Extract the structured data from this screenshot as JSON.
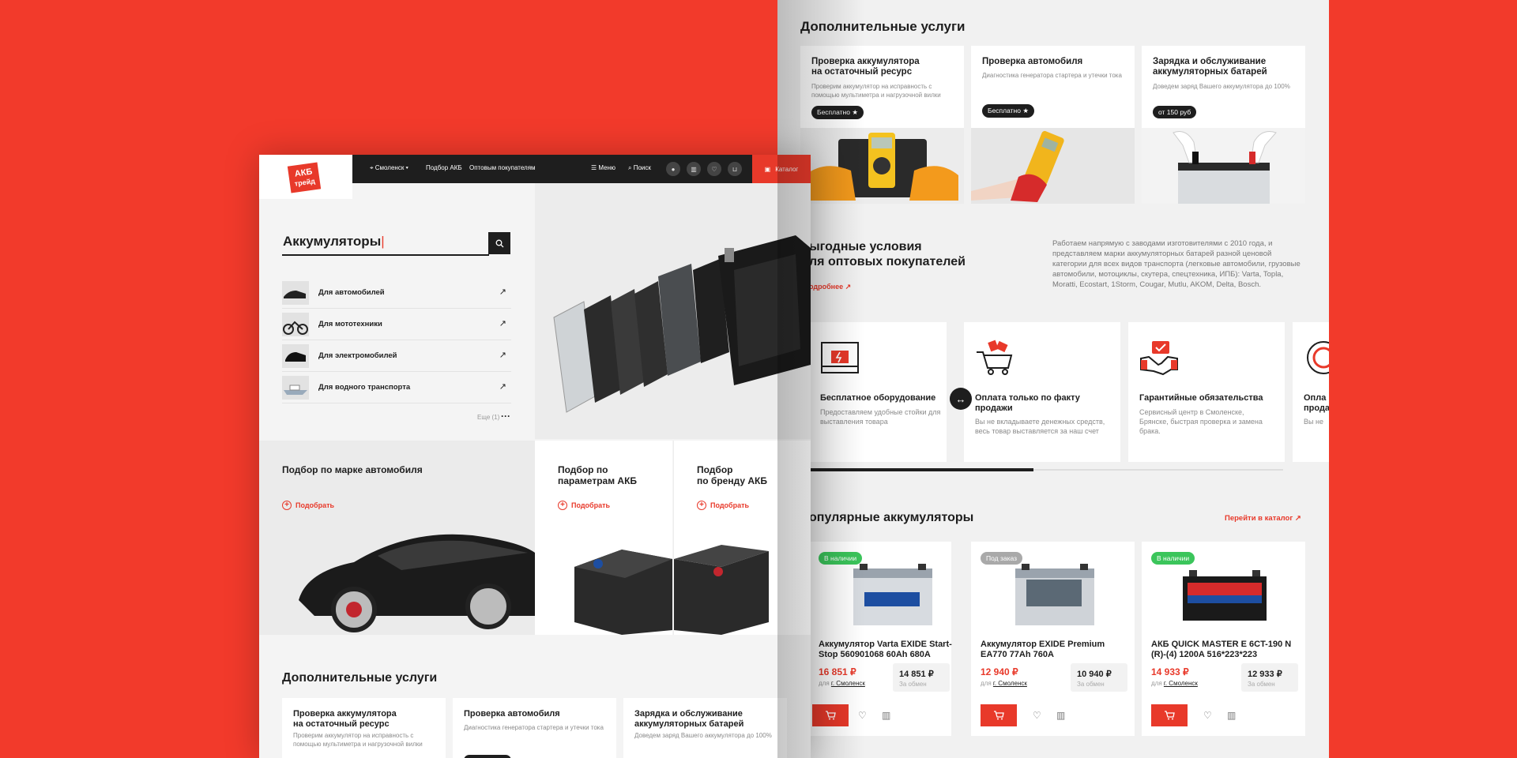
{
  "front": {
    "logo": {
      "line1": "АКБ",
      "line2": "трейд"
    },
    "nav": {
      "city": "Смоленск",
      "pick_akb": "Подбор АКБ",
      "wholesale": "Оптовым покупателям",
      "menu": "Меню",
      "search": "Поиск",
      "catalog": "Каталог"
    },
    "search": {
      "title": "Аккумуляторы"
    },
    "categories": [
      {
        "label": "Для автомобилей"
      },
      {
        "label": "Для мототехники"
      },
      {
        "label": "Для электромобилей"
      },
      {
        "label": "Для водного транспорта"
      }
    ],
    "more_label": "Еще (1)",
    "pickers": [
      {
        "title": "Подбор по марке автомобиля",
        "action": "Подобрать"
      },
      {
        "title_line1": "Подбор по",
        "title_line2": "параметрам АКБ",
        "action": "Подобрать"
      },
      {
        "title_line1": "Подбор",
        "title_line2": "по бренду АКБ",
        "action": "Подобрать"
      }
    ],
    "extra": {
      "title": "Дополнительные услуги",
      "cards": [
        {
          "title_line1": "Проверка аккумулятора",
          "title_line2": "на остаточный ресурс",
          "desc": "Проверим аккумулятор на исправность с помощью мультиметра и нагрузочной вилки"
        },
        {
          "title_line1": "Проверка автомобиля",
          "title_line2": "",
          "desc": "Диагностика генератора стартера и утечки тока"
        },
        {
          "title_line1": "Зарядка и обслуживание",
          "title_line2": "аккумуляторных батарей",
          "desc": "Доведем заряд Вашего аккумулятора до 100%"
        }
      ]
    }
  },
  "back": {
    "services": {
      "title": "Дополнительные услуги",
      "cards": [
        {
          "title_line1": "Проверка аккумулятора",
          "title_line2": "на остаточный ресурс",
          "desc": "Проверим аккумулятор на исправность с помощью мультиметра и нагрузочной вилки",
          "badge": "Бесплатно ★"
        },
        {
          "title_line1": "Проверка автомобиля",
          "title_line2": "",
          "desc": "Диагностика генератора стартера и утечки тока",
          "badge": "Бесплатно ★"
        },
        {
          "title_line1": "Зарядка и обслуживание",
          "title_line2": "аккумуляторных батарей",
          "desc": "Доведем заряд Вашего аккумулятора до 100%",
          "badge": "от 150 руб"
        }
      ]
    },
    "wholesale": {
      "title_line1": "ыгодные условия",
      "title_line2": "ля оптовых покупателей",
      "more": "одробнее",
      "text": "Работаем напрямую с заводами изготовителями с 2010 года, и представляем марки аккумуляторных батарей разной ценовой категории для всех видов транспорта (легковые автомобили, грузовые автомобили, мотоциклы, скутера, спецтехника, ИПБ): Varta, Topla, Moratti, Ecostart, 1Storm, Cougar, Mutlu, AKOM, Delta, Bosch."
    },
    "advantages": [
      {
        "title_line1": "Бесплатное оборудование",
        "title_line2": "",
        "desc": "Предоставляем удобные стойки для выставления товара"
      },
      {
        "title_line1": "Оплата только по факту",
        "title_line2": "продажи",
        "desc": "Вы не вкладываете денежных средств, весь товар выставляется за наш счет"
      },
      {
        "title_line1": "Гарантийные обязательства",
        "title_line2": "",
        "desc": "Сервисный центр в Смоленске, Брянске, быстрая проверка и замена брака."
      },
      {
        "title_line1": "Опла",
        "title_line2": "прода",
        "desc": "Вы не"
      }
    ],
    "popular": {
      "title": "опулярные аккумуляторы",
      "link": "Перейти в каталог ↗",
      "products": [
        {
          "status": "В наличии",
          "status_color": "#3bc55b",
          "name_line1": "Аккумулятор Varta EXIDE Start-",
          "name_line2": "Stop 560901068 60Ah 680A",
          "price": "16 851 ₽",
          "exchange_price": "14 851 ₽",
          "exchange_label": "За обмен",
          "loc_prefix": "для",
          "city": "г. Смоленск"
        },
        {
          "status": "Под заказ",
          "status_color": "#a9a9a9",
          "name_line1": "Аккумулятор EXIDE Premium",
          "name_line2": "EA770 77Ah 760A",
          "price": "12 940 ₽",
          "exchange_price": "10 940 ₽",
          "exchange_label": "За обмен",
          "loc_prefix": "для",
          "city": "г. Смоленск"
        },
        {
          "status": "В наличии",
          "status_color": "#3bc55b",
          "name_line1": "АКБ QUICK MASTER E 6CT-190 N",
          "name_line2": "(R)-(4) 1200A 516*223*223",
          "price": "14 933 ₽",
          "exchange_price": "12 933 ₽",
          "exchange_label": "За обмен",
          "loc_prefix": "для",
          "city": "г. Смоленск"
        }
      ]
    }
  }
}
